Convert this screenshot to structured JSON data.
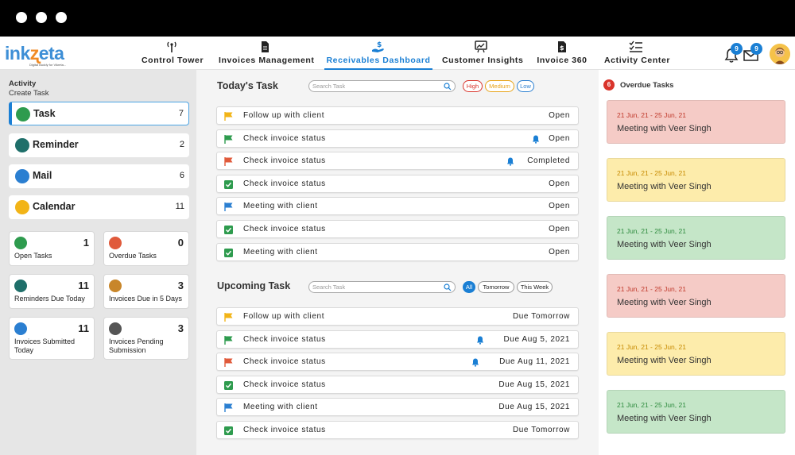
{
  "app": {
    "logo_main": "inkzeta",
    "logo_tagline": "Digital Buddy for Vikreta..."
  },
  "nav": [
    {
      "label": "Control Tower",
      "icon": "tower-icon"
    },
    {
      "label": "Invoices Management",
      "icon": "document-icon"
    },
    {
      "label": "Receivables Dashboard",
      "icon": "hand-dollar-icon",
      "active": true
    },
    {
      "label": "Customer Insights",
      "icon": "chart-board-icon"
    },
    {
      "label": "Invoice 360",
      "icon": "invoice-dollar-icon"
    },
    {
      "label": "Activity Center",
      "icon": "checklist-icon"
    }
  ],
  "header": {
    "notifications_count": "9",
    "mail_count": "9"
  },
  "sidebar": {
    "heading": "Activity",
    "create": "Create Task",
    "categories": [
      {
        "label": "Task",
        "count": "7",
        "color": "#2e9b4e"
      },
      {
        "label": "Reminder",
        "count": "2",
        "color": "#1f6f6a"
      },
      {
        "label": "Mail",
        "count": "6",
        "color": "#2b7fd1"
      },
      {
        "label": "Calendar",
        "count": "11",
        "color": "#f2b417"
      }
    ],
    "tiles": [
      {
        "label": "Open Tasks",
        "num": "1",
        "color": "#2e9b4e"
      },
      {
        "label": "Overdue Tasks",
        "num": "0",
        "color": "#e05a3b"
      },
      {
        "label": "Reminders Due Today",
        "num": "11",
        "color": "#1f6f6a"
      },
      {
        "label": "Invoices Due in 5 Days",
        "num": "3",
        "color": "#c8862a"
      },
      {
        "label": "Invoices Submitted Today",
        "num": "11",
        "color": "#2b7fd1"
      },
      {
        "label": "Invoices Pending Submission",
        "num": "3",
        "color": "#555555"
      }
    ]
  },
  "today": {
    "title": "Today's Task",
    "search_placeholder": "Search Task",
    "filters": [
      {
        "label": "High",
        "color": "#d9342b"
      },
      {
        "label": "Medium",
        "color": "#e8a317"
      },
      {
        "label": "Low",
        "color": "#2b7fd1"
      }
    ],
    "rows": [
      {
        "label": "Follow up with client",
        "status": "Open",
        "icon": "flag-yellow",
        "bell": false
      },
      {
        "label": "Check invoice status",
        "status": "Open",
        "icon": "flag-green",
        "bell": true
      },
      {
        "label": "Check invoice status",
        "status": "Completed",
        "icon": "flag-red",
        "bell": true
      },
      {
        "label": "Check invoice status",
        "status": "Open",
        "icon": "check-green",
        "bell": false
      },
      {
        "label": "Meeting with client",
        "status": "Open",
        "icon": "flag-blue",
        "bell": false
      },
      {
        "label": "Check invoice status",
        "status": "Open",
        "icon": "check-green",
        "bell": false
      },
      {
        "label": "Meeting with client",
        "status": "Open",
        "icon": "check-green",
        "bell": false
      }
    ]
  },
  "upcoming": {
    "title": "Upcoming Task",
    "search_placeholder": "Search Task",
    "filters": [
      "All",
      "Tomorrow",
      "This Week"
    ],
    "rows": [
      {
        "label": "Follow up with client",
        "status": "Due Tomorrow",
        "icon": "flag-yellow",
        "bell": false
      },
      {
        "label": "Check invoice status",
        "status": "Due Aug 5, 2021",
        "icon": "flag-green",
        "bell": true
      },
      {
        "label": "Check invoice status",
        "status": "Due Aug 11, 2021",
        "icon": "flag-red",
        "bell": true
      },
      {
        "label": "Check invoice status",
        "status": "Due Aug 15, 2021",
        "icon": "check-green",
        "bell": false
      },
      {
        "label": "Meeting with client",
        "status": "Due Aug 15, 2021",
        "icon": "flag-blue",
        "bell": false
      },
      {
        "label": "Check invoice status",
        "status": "Due Tomorrow",
        "icon": "check-green",
        "bell": false
      }
    ]
  },
  "overdue": {
    "count": "6",
    "title": "Overdue Tasks",
    "cards": [
      {
        "date": "21 Jun, 21 - 25 Jun, 21",
        "title": "Meeting with Veer Singh",
        "bg": "#f5cbc6",
        "date_color": "#c0392b"
      },
      {
        "date": "21 Jun, 21 - 25 Jun, 21",
        "title": "Meeting with Veer Singh",
        "bg": "#fdecab",
        "date_color": "#c78a00"
      },
      {
        "date": "21 Jun, 21 - 25 Jun, 21",
        "title": "Meeting with Veer Singh",
        "bg": "#c5e6c8",
        "date_color": "#2e8b3e"
      },
      {
        "date": "21 Jun, 21 - 25 Jun, 21",
        "title": "Meeting with Veer Singh",
        "bg": "#f5cbc6",
        "date_color": "#c0392b"
      },
      {
        "date": "21 Jun, 21 - 25 Jun, 21",
        "title": "Meeting with Veer Singh",
        "bg": "#fdecab",
        "date_color": "#c78a00"
      },
      {
        "date": "21 Jun, 21 - 25 Jun, 21",
        "title": "Meeting with Veer Singh",
        "bg": "#c5e6c8",
        "date_color": "#2e8b3e"
      }
    ]
  },
  "colors": {
    "accent": "#1a7fd4",
    "flag-yellow": "#f2b417",
    "flag-green": "#2e9b4e",
    "flag-red": "#e05a3b",
    "flag-blue": "#2b7fd1",
    "check-green": "#2e9b4e"
  }
}
